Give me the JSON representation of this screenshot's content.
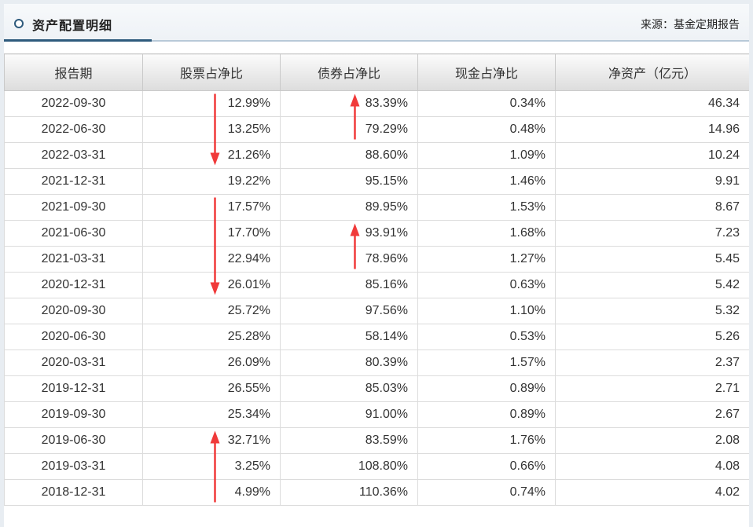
{
  "header": {
    "title": "资产配置明细",
    "source": "来源：基金定期报告"
  },
  "table": {
    "columns": [
      "报告期",
      "股票占净比",
      "债券占净比",
      "现金占净比",
      "净资产（亿元）"
    ],
    "rows": [
      {
        "date": "2022-09-30",
        "stock": "12.99%",
        "bond": "83.39%",
        "cash": "0.34%",
        "net": "46.34"
      },
      {
        "date": "2022-06-30",
        "stock": "13.25%",
        "bond": "79.29%",
        "cash": "0.48%",
        "net": "14.96"
      },
      {
        "date": "2022-03-31",
        "stock": "21.26%",
        "bond": "88.60%",
        "cash": "1.09%",
        "net": "10.24"
      },
      {
        "date": "2021-12-31",
        "stock": "19.22%",
        "bond": "95.15%",
        "cash": "1.46%",
        "net": "9.91"
      },
      {
        "date": "2021-09-30",
        "stock": "17.57%",
        "bond": "89.95%",
        "cash": "1.53%",
        "net": "8.67"
      },
      {
        "date": "2021-06-30",
        "stock": "17.70%",
        "bond": "93.91%",
        "cash": "1.68%",
        "net": "7.23"
      },
      {
        "date": "2021-03-31",
        "stock": "22.94%",
        "bond": "78.96%",
        "cash": "1.27%",
        "net": "5.45"
      },
      {
        "date": "2020-12-31",
        "stock": "26.01%",
        "bond": "85.16%",
        "cash": "0.63%",
        "net": "5.42"
      },
      {
        "date": "2020-09-30",
        "stock": "25.72%",
        "bond": "97.56%",
        "cash": "1.10%",
        "net": "5.32"
      },
      {
        "date": "2020-06-30",
        "stock": "25.28%",
        "bond": "58.14%",
        "cash": "0.53%",
        "net": "5.26"
      },
      {
        "date": "2020-03-31",
        "stock": "26.09%",
        "bond": "80.39%",
        "cash": "1.57%",
        "net": "2.37"
      },
      {
        "date": "2019-12-31",
        "stock": "26.55%",
        "bond": "85.03%",
        "cash": "0.89%",
        "net": "2.71"
      },
      {
        "date": "2019-09-30",
        "stock": "25.34%",
        "bond": "91.00%",
        "cash": "0.89%",
        "net": "2.67"
      },
      {
        "date": "2019-06-30",
        "stock": "32.71%",
        "bond": "83.59%",
        "cash": "1.76%",
        "net": "2.08"
      },
      {
        "date": "2019-03-31",
        "stock": "3.25%",
        "bond": "108.80%",
        "cash": "0.66%",
        "net": "4.08"
      },
      {
        "date": "2018-12-31",
        "stock": "4.99%",
        "bond": "110.36%",
        "cash": "0.74%",
        "net": "4.02"
      }
    ]
  },
  "annotations": {
    "arrow_color": "#f03a3a",
    "arrows": [
      {
        "column": "stock",
        "from_row": 0,
        "to_row": 2,
        "direction": "down"
      },
      {
        "column": "bond",
        "from_row": 1,
        "to_row": 0,
        "direction": "up"
      },
      {
        "column": "stock",
        "from_row": 4,
        "to_row": 7,
        "direction": "down"
      },
      {
        "column": "bond",
        "from_row": 6,
        "to_row": 5,
        "direction": "up"
      },
      {
        "column": "stock",
        "from_row": 15,
        "to_row": 13,
        "direction": "up"
      }
    ]
  }
}
